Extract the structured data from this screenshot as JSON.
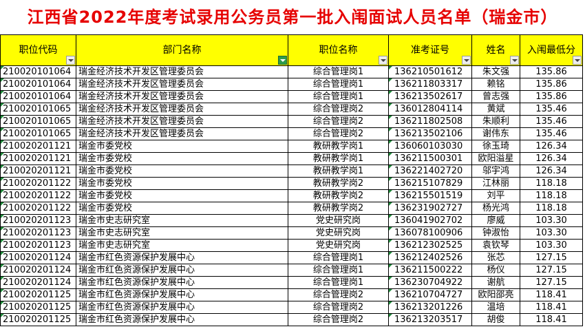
{
  "title": "江西省2022年度考试录用公务员第一批入闱面试人员名单（瑞金市）",
  "headers": {
    "position_code": "职位代码",
    "department": "部门名称",
    "position_name": "职位名称",
    "ticket": "准考证号",
    "name": "姓名",
    "min_score": "入闱最低分"
  },
  "colors": {
    "title": "#e60000",
    "header_bg": "#ffff00",
    "filter_active": "#2e9c4d"
  },
  "rows": [
    {
      "code": "210020101064",
      "dept": "瑞金经济技术开发区管理委员会",
      "pos": "综合管理岗1",
      "ticket": "136210501612",
      "name": "朱文强",
      "score": "135.86"
    },
    {
      "code": "210020101064",
      "dept": "瑞金经济技术开发区管理委员会",
      "pos": "综合管理岗1",
      "ticket": "136211803317",
      "name": "赖铭",
      "score": "135.86"
    },
    {
      "code": "210020101064",
      "dept": "瑞金经济技术开发区管理委员会",
      "pos": "综合管理岗1",
      "ticket": "136213502617",
      "name": "曾志强",
      "score": "135.86"
    },
    {
      "code": "210020101065",
      "dept": "瑞金经济技术开发区管理委员会",
      "pos": "综合管理岗2",
      "ticket": "136012804114",
      "name": "黄斌",
      "score": "135.46"
    },
    {
      "code": "210020101065",
      "dept": "瑞金经济技术开发区管理委员会",
      "pos": "综合管理岗2",
      "ticket": "136211802508",
      "name": "朱顺利",
      "score": "135.46"
    },
    {
      "code": "210020101065",
      "dept": "瑞金经济技术开发区管理委员会",
      "pos": "综合管理岗2",
      "ticket": "136213502106",
      "name": "谢伟东",
      "score": "135.46"
    },
    {
      "code": "210020201121",
      "dept": "瑞金市委党校",
      "pos": "教研教学岗1",
      "ticket": "136060103030",
      "name": "徐玉琦",
      "score": "126.34"
    },
    {
      "code": "210020201121",
      "dept": "瑞金市委党校",
      "pos": "教研教学岗1",
      "ticket": "136211500301",
      "name": "欧阳溢星",
      "score": "126.34"
    },
    {
      "code": "210020201121",
      "dept": "瑞金市委党校",
      "pos": "教研教学岗1",
      "ticket": "136221402720",
      "name": "邬宇鸿",
      "score": "126.34"
    },
    {
      "code": "210020201122",
      "dept": "瑞金市委党校",
      "pos": "教研教学岗2",
      "ticket": "136215107829",
      "name": "江林丽",
      "score": "118.18"
    },
    {
      "code": "210020201122",
      "dept": "瑞金市委党校",
      "pos": "教研教学岗2",
      "ticket": "136215501519",
      "name": "刘平",
      "score": "118.18"
    },
    {
      "code": "210020201122",
      "dept": "瑞金市委党校",
      "pos": "教研教学岗2",
      "ticket": "136231902727",
      "name": "杨光鸿",
      "score": "118.18"
    },
    {
      "code": "210020201123",
      "dept": "瑞金市史志研究室",
      "pos": "党史研究岗",
      "ticket": "136041902702",
      "name": "廖威",
      "score": "103.30"
    },
    {
      "code": "210020201123",
      "dept": "瑞金市史志研究室",
      "pos": "党史研究岗",
      "ticket": "136078100906",
      "name": "钟淑怡",
      "score": "103.30"
    },
    {
      "code": "210020201123",
      "dept": "瑞金市史志研究室",
      "pos": "党史研究岗",
      "ticket": "136212302525",
      "name": "袁钦琴",
      "score": "103.30"
    },
    {
      "code": "210020201124",
      "dept": "瑞金市红色资源保护发展中心",
      "pos": "综合管理岗1",
      "ticket": "136212402526",
      "name": "张芯",
      "score": "127.15"
    },
    {
      "code": "210020201124",
      "dept": "瑞金市红色资源保护发展中心",
      "pos": "综合管理岗1",
      "ticket": "136211500222",
      "name": "杨仪",
      "score": "127.15"
    },
    {
      "code": "210020201124",
      "dept": "瑞金市红色资源保护发展中心",
      "pos": "综合管理岗1",
      "ticket": "136230704922",
      "name": "谢航",
      "score": "127.15"
    },
    {
      "code": "210020201125",
      "dept": "瑞金市红色资源保护发展中心",
      "pos": "综合管理岗2",
      "ticket": "136210704727",
      "name": "欧阳邵亮",
      "score": "118.41"
    },
    {
      "code": "210020201125",
      "dept": "瑞金市红色资源保护发展中心",
      "pos": "综合管理岗2",
      "ticket": "136213201226",
      "name": "温培",
      "score": "118.41"
    },
    {
      "code": "210020201125",
      "dept": "瑞金市红色资源保护发展中心",
      "pos": "综合管理岗2",
      "ticket": "136213203517",
      "name": "胡俊",
      "score": "118.41"
    }
  ]
}
